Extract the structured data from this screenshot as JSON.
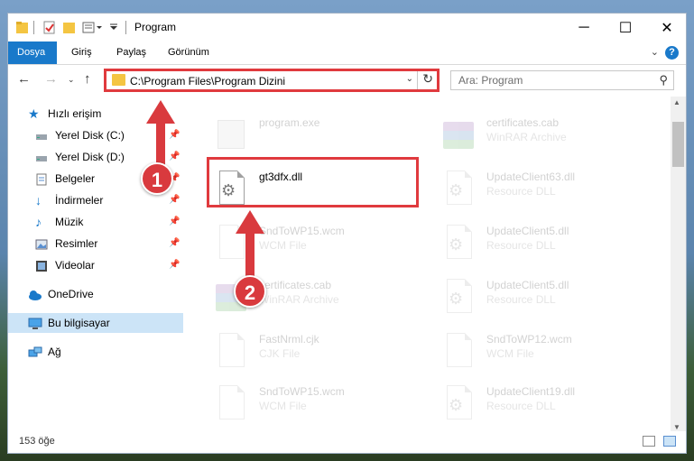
{
  "window": {
    "title": "Program",
    "controls": {
      "minimize": "─",
      "maximize": "☐",
      "close": "✕"
    }
  },
  "ribbon": {
    "tabs": [
      {
        "label": "Dosya",
        "active": true
      },
      {
        "label": "Giriş"
      },
      {
        "label": "Paylaş"
      },
      {
        "label": "Görünüm"
      }
    ],
    "help": "?"
  },
  "address": {
    "path": "C:\\Program Files\\Program Dizini",
    "search_placeholder": "Ara: Program"
  },
  "nav": {
    "items": [
      {
        "label": "Hızlı erişim",
        "icon": "star-icon"
      },
      {
        "label": "Yerel Disk (C:)",
        "icon": "drive-icon",
        "pinned": true
      },
      {
        "label": "Yerel Disk (D:)",
        "icon": "drive-icon",
        "pinned": true
      },
      {
        "label": "Belgeler",
        "icon": "documents-icon",
        "pinned": true
      },
      {
        "label": "İndirmeler",
        "icon": "download-icon",
        "pinned": true
      },
      {
        "label": "Müzik",
        "icon": "music-icon",
        "pinned": true
      },
      {
        "label": "Resimler",
        "icon": "pictures-icon",
        "pinned": true
      },
      {
        "label": "Videolar",
        "icon": "video-icon",
        "pinned": true
      },
      {
        "label": "OneDrive",
        "icon": "cloud-icon"
      },
      {
        "label": "Bu bilgisayar",
        "icon": "computer-icon",
        "selected": true
      },
      {
        "label": "Ağ",
        "icon": "network-icon"
      }
    ]
  },
  "files": [
    {
      "name": "program.exe",
      "type": "",
      "icon": "exe"
    },
    {
      "name": "certificates.cab",
      "type": "WinRAR Archive",
      "icon": "rar"
    },
    {
      "name": "gt3dfx.dll",
      "type": "",
      "icon": "dll",
      "highlighted": true
    },
    {
      "name": "UpdateClient63.dll",
      "type": "Resource DLL",
      "icon": "dll"
    },
    {
      "name": "SndToWP15.wcm",
      "type": "WCM File",
      "icon": "doc"
    },
    {
      "name": "UpdateClient5.dll",
      "type": "Resource DLL",
      "icon": "dll"
    },
    {
      "name": "certificates.cab",
      "type": "WinRAR Archive",
      "icon": "rar"
    },
    {
      "name": "UpdateClient5.dll",
      "type": "Resource DLL",
      "icon": "dll"
    },
    {
      "name": "FastNrml.cjk",
      "type": "CJK File",
      "icon": "doc"
    },
    {
      "name": "SndToWP12.wcm",
      "type": "WCM File",
      "icon": "doc"
    },
    {
      "name": "SndToWP15.wcm",
      "type": "WCM File",
      "icon": "doc"
    },
    {
      "name": "UpdateClient19.dll",
      "type": "Resource DLL",
      "icon": "dll"
    }
  ],
  "status": {
    "count": "153 öğe"
  },
  "annotations": {
    "step1": "1",
    "step2": "2"
  },
  "colors": {
    "accent": "#1979ca",
    "annotation": "#d93a3e"
  }
}
